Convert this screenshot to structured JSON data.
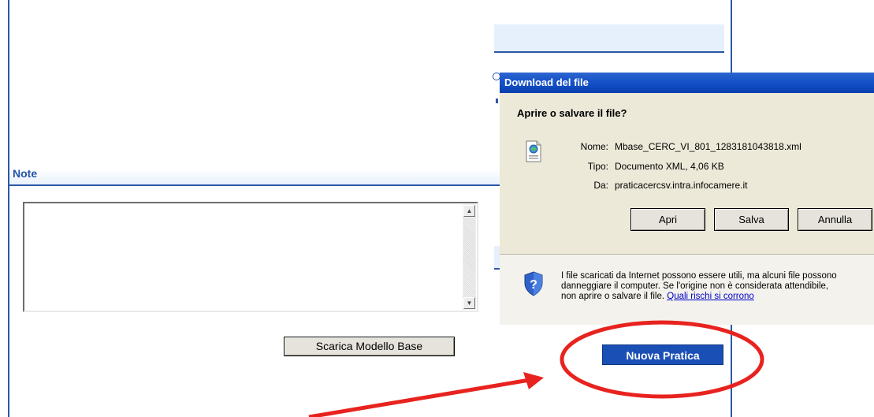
{
  "note": {
    "title": "Note",
    "textarea_value": ""
  },
  "scarica_button": "Scarica Modello Base",
  "dialog": {
    "title": "Download del file",
    "question": "Aprire o salvare il file?",
    "name_label": "Nome:",
    "name_value": "Mbase_CERC_VI_801_1283181043818.xml",
    "type_label": "Tipo:",
    "type_value": "Documento XML, 4,06 KB",
    "from_label": "Da:",
    "from_value": "praticacercsv.intra.infocamere.it",
    "open_button": "Apri",
    "save_button": "Salva",
    "cancel_button": "Annulla",
    "warning_line1": "I file scaricati da Internet possono essere utili, ma alcuni file possono",
    "warning_line2": "danneggiare il computer. Se l'origine non è considerata attendibile,",
    "warning_line3": "non aprire o salvare il file.",
    "warning_link": "Quali rischi si corrono"
  },
  "nuova_pratica_button": "Nuova Pratica",
  "annotation": {
    "color": "#e8231f"
  },
  "icons": {
    "file": "xml-file-icon",
    "help": "shield-question-icon"
  }
}
